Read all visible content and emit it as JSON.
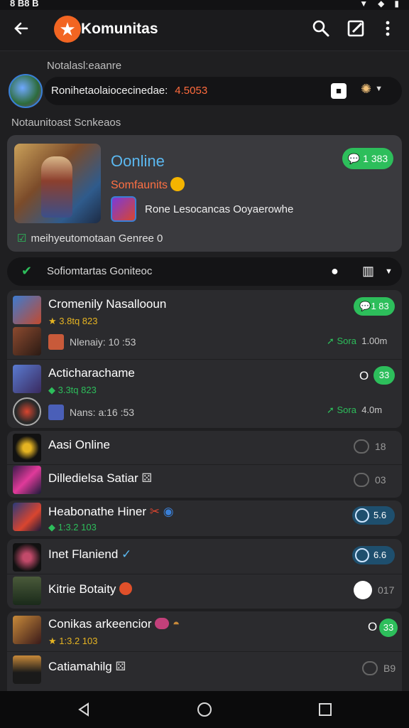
{
  "status_bar": {
    "time": "8 B8 B",
    "icons": [
      "signal-icon",
      "wifi-icon",
      "battery-icon"
    ]
  },
  "app_bar": {
    "title": "Komunitas",
    "logo_glyph": "★"
  },
  "section1_label": "Notalasl:eaanre",
  "user": {
    "name": "Ronihetaolaiocecinedae:",
    "points": "4.5053"
  },
  "section2_label": "Notaunitoast Scnkeaos",
  "featured": {
    "title": "Oonline",
    "subtitle": "Somfaunits",
    "description": "Rone Lesocancas Ooyaerowhe",
    "badge": "1 383",
    "stat": "meihyeutomotaan Genree 0"
  },
  "filter": {
    "label": "Sofiomtartas Goniteoc"
  },
  "rows": [
    {
      "title": "Cromenily Nasallooun",
      "meta": "3.8tq 823",
      "sub": "Nlenaiy: 10 :53",
      "badge": "1 83",
      "status": "Sora",
      "time": "1.00m"
    },
    {
      "title": "Acticharachame",
      "meta": "3.3tq 823",
      "sub": "Nans: a:16 :53",
      "badge": "33",
      "status": "Sora",
      "time": "4.0m"
    },
    {
      "title": "Aasi Online",
      "tag": "18"
    },
    {
      "title": "Dilledielsa Satiar",
      "tag": "03"
    },
    {
      "title": "Heabonathe Hiner",
      "meta": "1:3.2 103",
      "badge": "5.6"
    },
    {
      "title": "Inet Flaniend",
      "badge": "6.6"
    },
    {
      "title": "Kitrie Botaity",
      "tag": "017"
    },
    {
      "title": "Conikas arkeencior",
      "meta": "1:3.2 103",
      "badge": "33"
    },
    {
      "title": "Catiamahilg",
      "tag": "B9"
    }
  ],
  "colors": {
    "accent_green": "#2dbe5b",
    "accent_orange": "#f26522",
    "link_blue": "#5bb8f0",
    "background": "#1f1f21"
  }
}
